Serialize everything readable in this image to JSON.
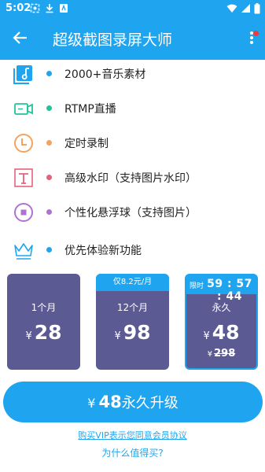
{
  "status": {
    "time": "5:02"
  },
  "app_bar": {
    "title": "超级截图录屏大师"
  },
  "features": [
    {
      "label": "2000+音乐素材",
      "bullet_color": "#1fa5f0",
      "icon": "music-library-icon"
    },
    {
      "label": "RTMP直播",
      "bullet_color": "#22c29a",
      "icon": "video-camera-icon"
    },
    {
      "label": "定时录制",
      "bullet_color": "#f5a25d",
      "icon": "clock-icon"
    },
    {
      "label": "高级水印（支持图片水印）",
      "bullet_color": "#e8617a",
      "icon": "text-watermark-icon"
    },
    {
      "label": "个性化悬浮球（支持图片）",
      "bullet_color": "#b072d0",
      "icon": "floating-ball-icon"
    },
    {
      "label": "优先体验新功能",
      "bullet_color": "#1fa5f0",
      "icon": "crown-icon"
    }
  ],
  "plans": {
    "monthly": {
      "period": "1个月",
      "currency": "¥",
      "price": "28"
    },
    "yearly": {
      "tag": "仅8.2元/月",
      "period": "12个月",
      "currency": "¥",
      "price": "98"
    },
    "lifetime": {
      "timer_label": "限时",
      "timer": "59 : 57 : 44",
      "period": "永久",
      "currency": "¥",
      "price": "48",
      "orig_currency": "¥",
      "orig_price": "298"
    }
  },
  "buy_button": {
    "currency": "¥",
    "price": "48",
    "label": "永久升级"
  },
  "agreement": "购买VIP表示您同意会员协议",
  "why": "为什么值得买?"
}
